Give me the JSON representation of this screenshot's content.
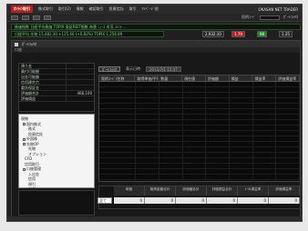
{
  "menubar": {
    "brand": "ｵﾝﾗｲﾝ取引",
    "items": [
      "株式取引",
      "取引(2)",
      "情報",
      "確認取引",
      "投資信託",
      "取引",
      "ﾏｲﾍﾟｰｼﾞ他"
    ],
    "app_title": "OKASAN NET TRADER"
  },
  "toolbar": {
    "label": "銘柄ｺｰﾄﾞ",
    "right_label": "ﾎﾟｰﾄﾌｫﾘｵ"
  },
  "ticker": {
    "line1": "株価指数 日経平均株価 TOPIX 東証REIT指数 為替 ﾆｭｰｽ 市況 ｺﾒﾝﾄ ...",
    "line2": "日経平均 先物 15,482.30 +125.40 (+0.82%) TOPIX 1,256.89",
    "quotes": [
      "2,932.10",
      "1.79",
      "98",
      "1.25"
    ]
  },
  "panel": {
    "title": "ﾎﾟｰﾄﾌｫﾘｵ",
    "subtitle": "口座"
  },
  "info": {
    "rows": [
      {
        "k": "預り金",
        "v": ""
      },
      {
        "k": "買付可能額",
        "v": ""
      },
      {
        "k": "出金可能額",
        "v": ""
      },
      {
        "k": "信用建余力",
        "v": ""
      },
      {
        "k": "委託保証金",
        "v": ""
      },
      {
        "k": "評価額合計",
        "v": "468,100"
      },
      {
        "k": "評価損益",
        "v": ""
      }
    ]
  },
  "tree": {
    "items": [
      "現物",
      "国内株式",
      "株式",
      "投資信託",
      "外国株",
      "先物OP",
      "先物",
      "オプション",
      "CFD",
      "信用取引",
      "口座管理",
      "入出金",
      "信用",
      "現引",
      "ログ"
    ]
  },
  "main": {
    "button": "ﾎﾟｰﾄﾌｫﾘｵ",
    "date_label": "表示日時",
    "date_value": "2013/7/1 15:47",
    "columns": [
      "銘柄ｺｰﾄﾞ/名称",
      "取得単価/平均",
      "数量",
      "現在値",
      "評価額",
      "損益",
      "損益率",
      "評価損益率"
    ]
  },
  "bottom": {
    "select": "全て",
    "headers": [
      "時価",
      "取得金額合計",
      "評価額合計",
      "評価損益合計",
      "ﾄｰﾀﾙ損益率",
      "評価損益率"
    ],
    "values": [
      "0",
      "0",
      "0",
      "0",
      "0",
      "0"
    ]
  }
}
